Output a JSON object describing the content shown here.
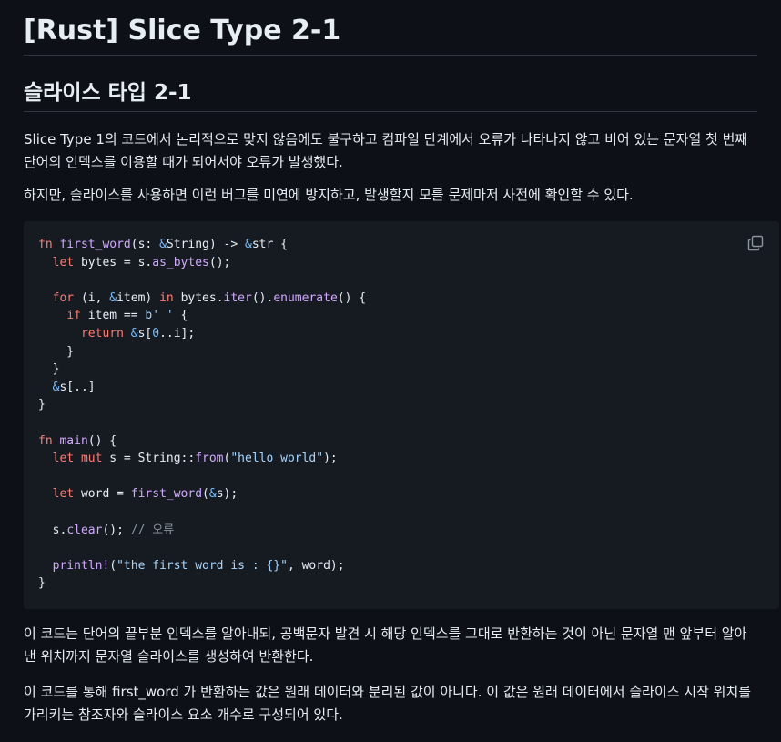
{
  "title": "[Rust] Slice Type 2-1",
  "section_heading": "슬라이스 타입 2-1",
  "paragraphs": {
    "p1": "Slice Type 1의 코드에서 논리적으로 맞지 않음에도 불구하고 컴파일 단계에서 오류가 나타나지 않고 비어 있는 문자열 첫 번째 단어의 인덱스를 이용할 때가 되어서야 오류가 발생했다.",
    "p2": "하지만, 슬라이스를 사용하면 이런 버그를 미연에 방지하고, 발생할지 모를 문제마저 사전에 확인할 수 있다.",
    "p3": "이 코드는 단어의 끝부분 인덱스를 알아내되, 공백문자 발견 시 해당 인덱스를 그대로 반환하는 것이 아닌 문자열 맨 앞부터 알아낸 위치까지 문자열 슬라이스를 생성하여 반환한다.",
    "p4": "이 코드를 통해 first_word 가 반환하는 값은 원래 데이터와 분리된 값이 아니다. 이 값은 원래 데이터에서 슬라이스 시작 위치를 가리키는 참조자와 슬라이스 요소 개수로 구성되어 있다."
  },
  "code": {
    "language": "rust",
    "copy_icon": "copy-icon",
    "lines": [
      [
        [
          "kw",
          "fn "
        ],
        [
          "fn",
          "first_word"
        ],
        [
          "ty",
          "(s: "
        ],
        [
          "op",
          "&"
        ],
        [
          "ty",
          "String) -> "
        ],
        [
          "op",
          "&"
        ],
        [
          "ty",
          "str {"
        ]
      ],
      [
        [
          "ty",
          "  "
        ],
        [
          "kw",
          "let "
        ],
        [
          "ty",
          "bytes = s."
        ],
        [
          "fn",
          "as_bytes"
        ],
        [
          "ty",
          "();"
        ]
      ],
      [],
      [
        [
          "ty",
          "  "
        ],
        [
          "kw",
          "for "
        ],
        [
          "ty",
          "(i, "
        ],
        [
          "op",
          "&"
        ],
        [
          "ty",
          "item) "
        ],
        [
          "kw",
          "in "
        ],
        [
          "ty",
          "bytes."
        ],
        [
          "fn",
          "iter"
        ],
        [
          "ty",
          "()."
        ],
        [
          "fn",
          "enumerate"
        ],
        [
          "ty",
          "() {"
        ]
      ],
      [
        [
          "ty",
          "    "
        ],
        [
          "kw",
          "if "
        ],
        [
          "ty",
          "item == "
        ],
        [
          "str",
          "b' '"
        ],
        [
          "ty",
          " {"
        ]
      ],
      [
        [
          "ty",
          "      "
        ],
        [
          "kw",
          "return "
        ],
        [
          "op",
          "&"
        ],
        [
          "ty",
          "s["
        ],
        [
          "num",
          "0"
        ],
        [
          "ty",
          ".."
        ],
        [
          "ty",
          "i];"
        ]
      ],
      [
        [
          "ty",
          "    }"
        ]
      ],
      [
        [
          "ty",
          "  }"
        ]
      ],
      [
        [
          "ty",
          "  "
        ],
        [
          "op",
          "&"
        ],
        [
          "ty",
          "s[..]"
        ]
      ],
      [
        [
          "ty",
          "}"
        ]
      ],
      [],
      [
        [
          "kw",
          "fn "
        ],
        [
          "fn",
          "main"
        ],
        [
          "ty",
          "() {"
        ]
      ],
      [
        [
          "ty",
          "  "
        ],
        [
          "kw",
          "let mut "
        ],
        [
          "ty",
          "s = String::"
        ],
        [
          "fn",
          "from"
        ],
        [
          "ty",
          "("
        ],
        [
          "str",
          "\"hello world\""
        ],
        [
          "ty",
          ");"
        ]
      ],
      [],
      [
        [
          "ty",
          "  "
        ],
        [
          "kw",
          "let "
        ],
        [
          "ty",
          "word = "
        ],
        [
          "fn",
          "first_word"
        ],
        [
          "ty",
          "("
        ],
        [
          "op",
          "&"
        ],
        [
          "ty",
          "s);"
        ]
      ],
      [],
      [
        [
          "ty",
          "  s."
        ],
        [
          "fn",
          "clear"
        ],
        [
          "ty",
          "(); "
        ],
        [
          "cm",
          "// 오류"
        ]
      ],
      [],
      [
        [
          "ty",
          "  "
        ],
        [
          "mac",
          "println!"
        ],
        [
          "ty",
          "("
        ],
        [
          "str",
          "\"the first word is : {}\""
        ],
        [
          "ty",
          ", word);"
        ]
      ],
      [
        [
          "ty",
          "}"
        ]
      ]
    ]
  }
}
